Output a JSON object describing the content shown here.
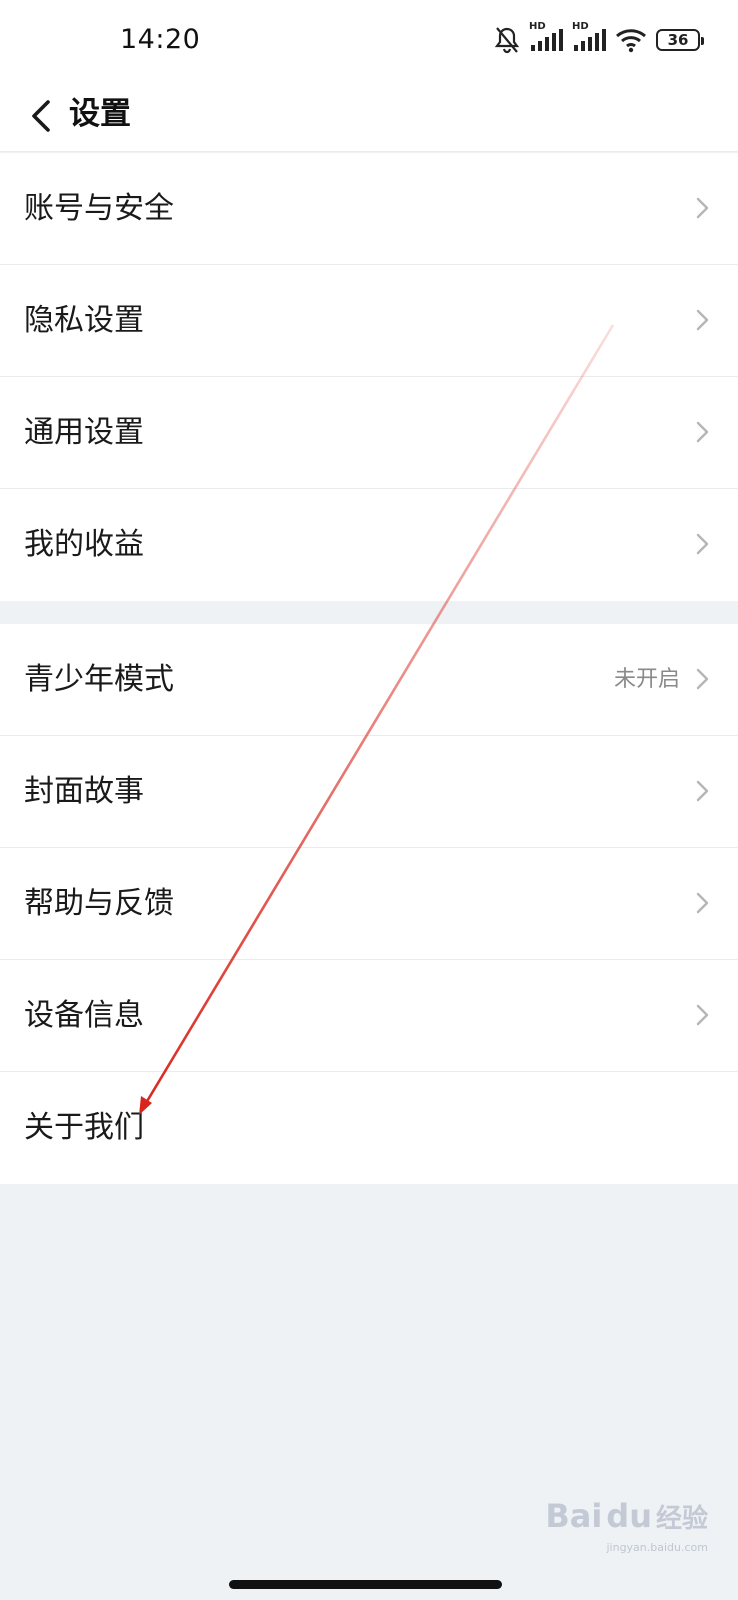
{
  "status_bar": {
    "time": "14:20",
    "icons": [
      "bell-muted-icon",
      "signal-hd-icon",
      "signal-hd-icon",
      "wifi-icon",
      "battery-icon"
    ],
    "hd_label": "HD",
    "battery_level": "36"
  },
  "header": {
    "back_icon": "chevron-left-icon",
    "title": "设置"
  },
  "groups": [
    {
      "items": [
        {
          "label": "账号与安全",
          "chevron": true
        },
        {
          "label": "隐私设置",
          "chevron": true
        },
        {
          "label": "通用设置",
          "chevron": true
        },
        {
          "label": "我的收益",
          "chevron": true
        }
      ]
    },
    {
      "items": [
        {
          "label": "青少年模式",
          "value": "未开启",
          "chevron": true
        },
        {
          "label": "封面故事",
          "chevron": true
        },
        {
          "label": "帮助与反馈",
          "chevron": true
        },
        {
          "label": "设备信息",
          "chevron": true
        },
        {
          "label": "关于我们",
          "chevron": false
        }
      ]
    }
  ],
  "annotation": {
    "color": "#d9261c",
    "points_to": "关于我们"
  },
  "watermark": {
    "brand": "Bai",
    "brand_suffix": "du",
    "sub": "经验",
    "url": "jingyan.baidu.com"
  },
  "colors": {
    "background": "#eff2f5",
    "surface": "#ffffff",
    "divider": "#ececec",
    "secondary_text": "#8a8a8a"
  }
}
